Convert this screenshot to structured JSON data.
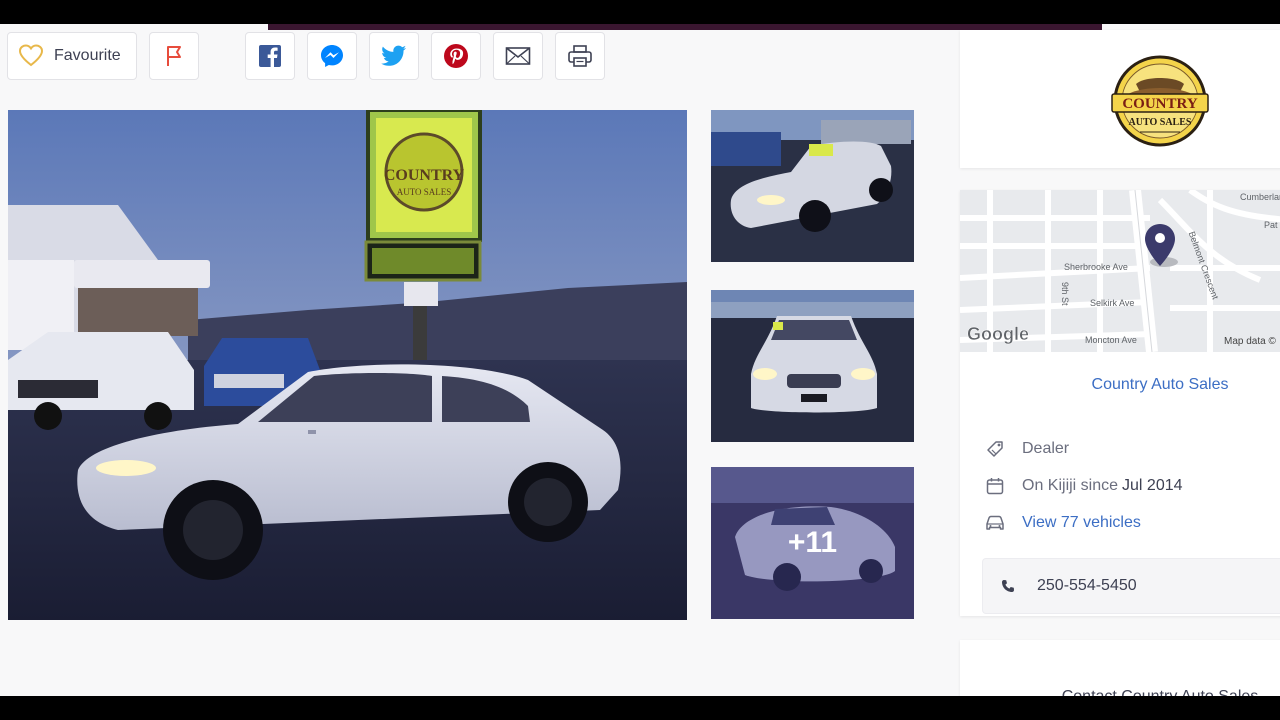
{
  "toolbar": {
    "favourite_label": "Favourite"
  },
  "gallery": {
    "more_photos": "+11",
    "main_sign_text": "COUNTRY",
    "main_sign_sub": "AUTO SALES"
  },
  "dealer": {
    "logo_top": "COUNTRY",
    "logo_bottom": "AUTO SALES",
    "name": "Country Auto Sales",
    "type": "Dealer",
    "since_prefix": "On Kijiji since",
    "since_date": "Jul 2014",
    "vehicles_link": "View 77 vehicles",
    "phone": "250-554-5450",
    "contact_label": "Contact Country Auto Sales"
  },
  "map": {
    "labels": [
      "Cumberland",
      "Pat",
      "Belmont Crescent",
      "Sherbrooke Ave",
      "9th St",
      "Selkirk Ave",
      "Moncton Ave"
    ],
    "google": "Google",
    "map_data": "Map data ©"
  },
  "colors": {
    "accent": "#3c6ec4",
    "pinterest": "#bd081c",
    "facebook": "#3b5998",
    "twitter": "#1da1f2",
    "messenger": "#0084ff",
    "flag": "#e74c3c"
  }
}
